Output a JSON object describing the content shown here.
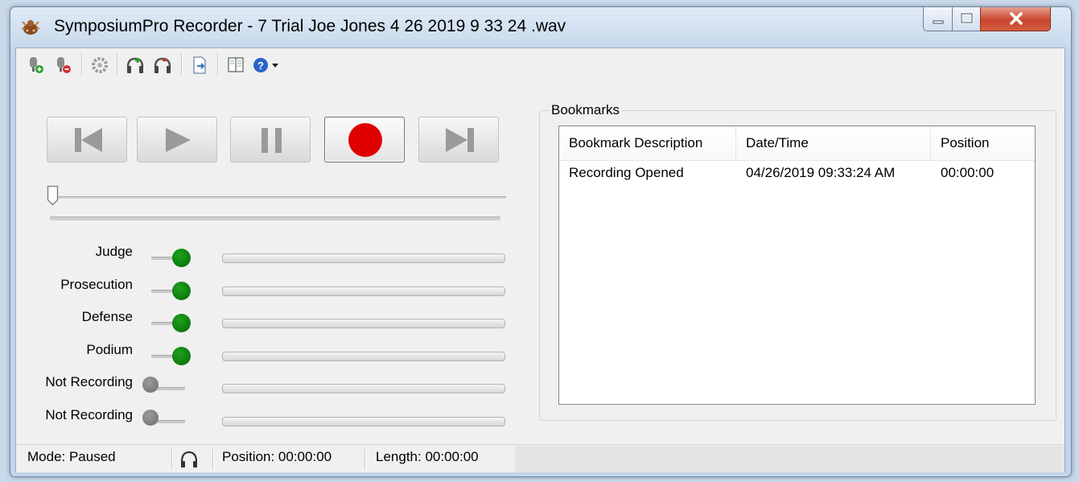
{
  "window": {
    "title": "SymposiumPro Recorder - 7 Trial Joe Jones 4 26 2019 9 33 24 .wav",
    "icons": [
      "minimize-icon",
      "maximize-icon",
      "close-icon"
    ]
  },
  "toolbar": {
    "icons": [
      "add-mic-icon",
      "remove-mic-icon",
      "settings-gear-icon",
      "add-channel-icon",
      "remove-channel-icon",
      "export-document-icon",
      "notebook-icon",
      "help-icon"
    ]
  },
  "transport": {
    "buttons": [
      "skip-back",
      "play",
      "pause",
      "record",
      "skip-forward"
    ],
    "record_color": "#e00000",
    "seek_position": 0
  },
  "channels": [
    {
      "label": "Judge",
      "on": true
    },
    {
      "label": "Prosecution",
      "on": true
    },
    {
      "label": "Defense",
      "on": true
    },
    {
      "label": "Podium",
      "on": true
    },
    {
      "label": "Not Recording",
      "on": false
    },
    {
      "label": "Not Recording",
      "on": false
    }
  ],
  "bookmarks": {
    "group_label": "Bookmarks",
    "columns": [
      "Bookmark Description",
      "Date/Time",
      "Position"
    ],
    "rows": [
      [
        "Recording Opened",
        "04/26/2019 09:33:24 AM",
        "00:00:00"
      ]
    ]
  },
  "status": {
    "mode": "Mode: Paused",
    "position": "Position: 00:00:00",
    "length": "Length: 00:00:00",
    "headphones_icon": "headphones-icon"
  },
  "colors": {
    "channel_on": "#0c7a0c",
    "channel_off": "#7b7b7b",
    "close_button": "#c9452d"
  }
}
